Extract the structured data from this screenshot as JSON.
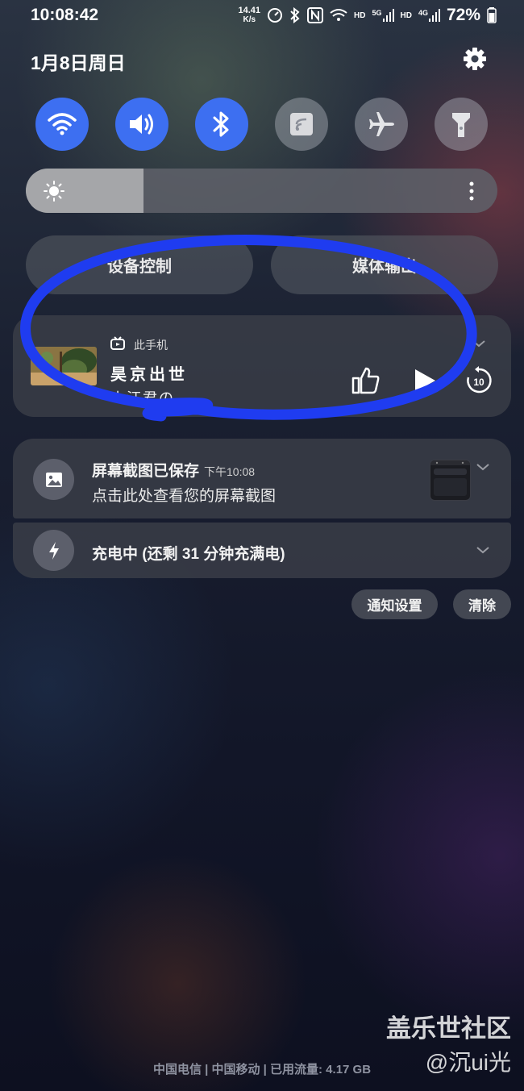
{
  "status_bar": {
    "time": "10:08:42",
    "net_speed_value": "14.41",
    "net_speed_unit": "K/s",
    "hd_label_1": "HD",
    "signal_5g_label": "5G",
    "hd_label_2": "HD",
    "signal_4g_label": "4G",
    "battery_percent": "72%",
    "icons": [
      "speed-icon",
      "bluetooth-icon",
      "nfc-icon",
      "wifi-icon",
      "signal-icon",
      "battery-icon"
    ]
  },
  "header": {
    "date": "1月8日周日",
    "settings_icon": "gear-icon"
  },
  "quick_tiles": [
    {
      "name": "wifi",
      "state": "on",
      "icon": "wifi-icon"
    },
    {
      "name": "sound",
      "state": "on",
      "icon": "volume-icon"
    },
    {
      "name": "bluetooth",
      "state": "on",
      "icon": "bluetooth-icon"
    },
    {
      "name": "nfc",
      "state": "off",
      "icon": "nfc-icon"
    },
    {
      "name": "airplane-mode",
      "state": "off",
      "icon": "airplane-icon"
    },
    {
      "name": "flashlight",
      "state": "off",
      "icon": "flashlight-icon"
    }
  ],
  "brightness": {
    "level": 0.25,
    "icon": "sun-icon"
  },
  "control_buttons": {
    "device_control": "设备控制",
    "media_output": "媒体输出"
  },
  "media": {
    "source": "此手机",
    "title": "昊京出世",
    "artist": "小汪君の",
    "controls": [
      "thumbs-up-icon",
      "play-icon",
      "forward-10-icon"
    ]
  },
  "notifications": [
    {
      "title": "屏幕截图已保存",
      "time": "下午10:08",
      "text": "点击此处查看您的屏幕截图",
      "icon": "image-icon"
    },
    {
      "title": "充电中 (还剩 31 分钟充满电)",
      "icon": "bolt-icon"
    }
  ],
  "actions": {
    "notification_settings": "通知设置",
    "clear": "清除"
  },
  "watermark": {
    "site": "盖乐世社区",
    "user": "@沉ui光"
  },
  "carrier_info": "中国电信 | 中国移动 | 已用流量: 4.17 GB",
  "colors": {
    "accent": "#3d6ff1",
    "annotation": "#1f3cf0"
  }
}
